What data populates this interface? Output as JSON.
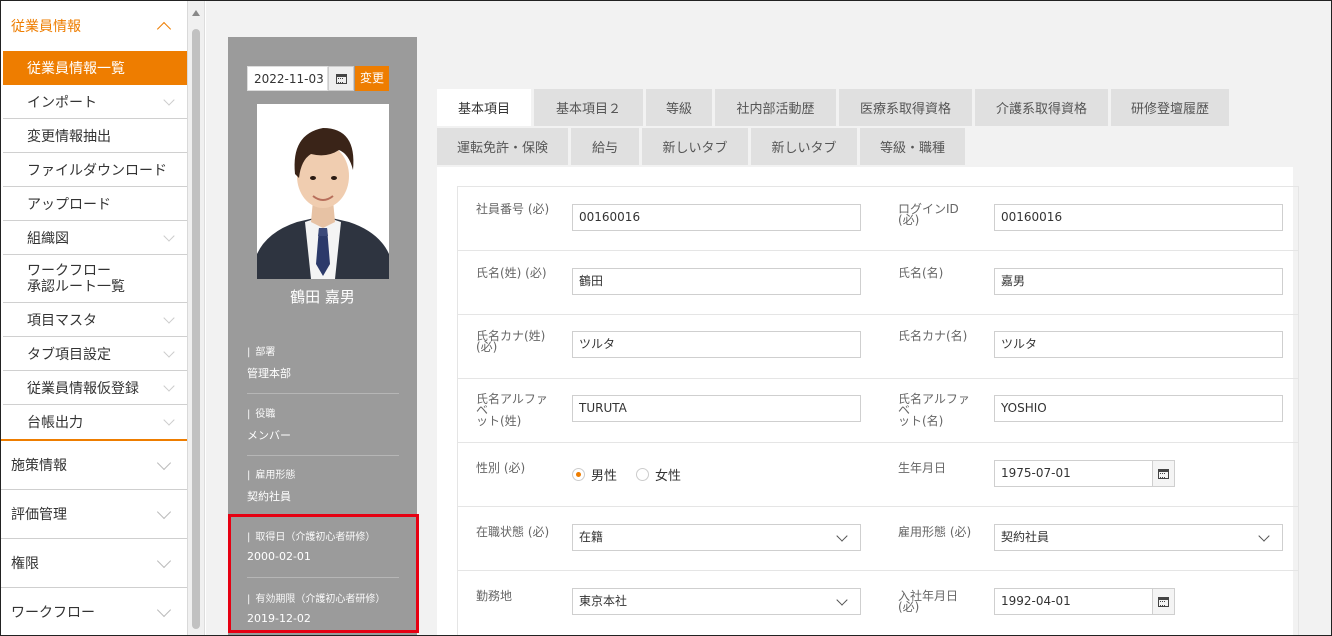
{
  "sidebar": {
    "active_section": "従業員情報",
    "items": [
      {
        "label": "従業員情報一覧",
        "selected": true
      },
      {
        "label": "インポート",
        "expandable": true
      },
      {
        "label": "変更情報抽出"
      },
      {
        "label": "ファイルダウンロード"
      },
      {
        "label": "アップロード"
      },
      {
        "label": "組織図",
        "expandable": true
      },
      {
        "label_line1": "ワークフロー",
        "label_line2": "承認ルート一覧"
      },
      {
        "label": "項目マスタ",
        "expandable": true
      },
      {
        "label": "タブ項目設定",
        "expandable": true
      },
      {
        "label": "従業員情報仮登録",
        "expandable": true
      },
      {
        "label": "台帳出力",
        "expandable": true
      }
    ],
    "sections": [
      {
        "label": "施策情報"
      },
      {
        "label": "評価管理"
      },
      {
        "label": "権限"
      },
      {
        "label": "ワークフロー"
      }
    ]
  },
  "profile": {
    "date_value": "2022-11-03",
    "change_label": "変更",
    "name": "鶴田 嘉男",
    "fields": [
      {
        "label": "部署",
        "value": "管理本部"
      },
      {
        "label": "役職",
        "value": "メンバー"
      },
      {
        "label": "雇用形態",
        "value": "契約社員"
      },
      {
        "label": "取得日（介護初心者研修）",
        "value": "2000-02-01"
      },
      {
        "label": "有効期限（介護初心者研修）",
        "value": "2019-12-02"
      }
    ]
  },
  "tabs": {
    "row1": [
      "基本項目",
      "基本項目２",
      "等級",
      "社内部活動歴",
      "医療系取得資格",
      "介護系取得資格",
      "研修登壇履歴"
    ],
    "row2": [
      "運転免許・保険",
      "給与",
      "新しいタブ",
      "新しいタブ",
      "等級・職種"
    ],
    "active": "基本項目"
  },
  "form": {
    "employee_no_label": "社員番号 (必)",
    "employee_no": "00160016",
    "login_id_label": "ログインID (必)",
    "login_id": "00160016",
    "last_name_label": "氏名(姓) (必)",
    "last_name": "鶴田",
    "first_name_label": "氏名(名)",
    "first_name": "嘉男",
    "last_kana_label_1": "氏名カナ(姓)",
    "last_kana_label_2": "(必)",
    "last_kana": "ツルタ",
    "first_kana_label": "氏名カナ(名)",
    "first_kana": "ツルタ",
    "last_alpha_label_1": "氏名アルファベ",
    "last_alpha_label_2": "ット(姓)",
    "last_alpha": "TURUTA",
    "first_alpha_label_1": "氏名アルファベ",
    "first_alpha_label_2": "ット(名)",
    "first_alpha": "YOSHIO",
    "gender_label": "性別 (必)",
    "gender_male": "男性",
    "gender_female": "女性",
    "gender_selected": "男性",
    "birth_label": "生年月日",
    "birth": "1975-07-01",
    "status_label": "在職状態 (必)",
    "status": "在籍",
    "employment_label": "雇用形態 (必)",
    "employment": "契約社員",
    "workplace_label": "勤務地",
    "workplace": "東京本社",
    "join_label": "入社年月日 (必)",
    "join_date": "1992-04-01"
  },
  "colors": {
    "accent": "#ee7d00",
    "highlight": "#e60012",
    "profile_bg": "#9b9b9b"
  }
}
